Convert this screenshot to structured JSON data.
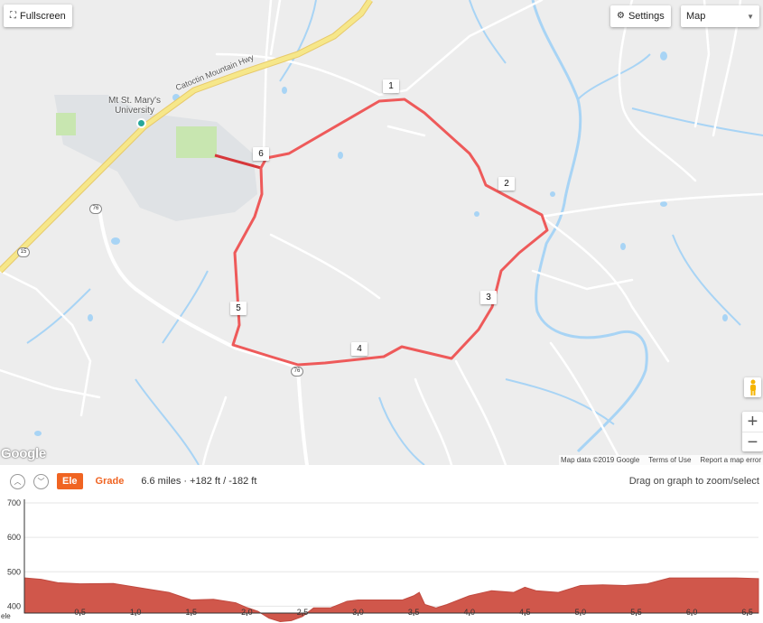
{
  "map": {
    "fullscreen_label": "Fullscreen",
    "settings_label": "Settings",
    "map_type": "Map",
    "place_label": "Mt St. Mary's\nUniversity",
    "highway_label": "Catoctin Mountain Hwy",
    "shields": [
      "76",
      "15",
      "76"
    ],
    "mile_markers": [
      "1",
      "2",
      "3",
      "4",
      "5",
      "6"
    ],
    "google_logo": "Google",
    "attribution": [
      "Map data ©2019 Google",
      "Terms of Use",
      "Report a map error"
    ],
    "zoom_in": "+",
    "zoom_out": "−",
    "colors": {
      "route": "#ee5a5a",
      "water": "#a8d4f5",
      "land": "#ededed",
      "road": "#ffffff",
      "highway": "#f6e78a"
    }
  },
  "elevation": {
    "ele_tab": "Ele",
    "grade_tab": "Grade",
    "stats": "6.6 miles · +182 ft / -182 ft",
    "drag_hint": "Drag on graph to zoom/select",
    "up_icon": "chevron-up-icon",
    "down_icon": "chevron-down-icon"
  },
  "chart_data": {
    "type": "area",
    "title": "",
    "xlabel": "",
    "ylabel": "ele",
    "xlim": [
      0,
      6.6
    ],
    "ylim": [
      380,
      700
    ],
    "y_ticks": [
      "700",
      "600",
      "500",
      "400"
    ],
    "x_ticks": [
      "0.5",
      "1.0",
      "1.5",
      "2.0",
      "2.5",
      "3.0",
      "3.5",
      "4.0",
      "4.5",
      "5.0",
      "5.5",
      "6.0",
      "6.5"
    ],
    "fill_color": "#d0574b",
    "x": [
      0,
      0.15,
      0.3,
      0.5,
      0.8,
      1.1,
      1.3,
      1.5,
      1.7,
      1.9,
      2.0,
      2.1,
      2.2,
      2.3,
      2.4,
      2.5,
      2.6,
      2.75,
      2.9,
      3.0,
      3.2,
      3.4,
      3.5,
      3.55,
      3.6,
      3.7,
      3.8,
      4.0,
      4.2,
      4.4,
      4.5,
      4.6,
      4.8,
      5.0,
      5.2,
      5.4,
      5.6,
      5.8,
      6.0,
      6.2,
      6.4,
      6.6
    ],
    "values": [
      482,
      478,
      468,
      465,
      466,
      450,
      440,
      418,
      420,
      410,
      396,
      385,
      365,
      355,
      358,
      370,
      395,
      395,
      414,
      418,
      418,
      418,
      430,
      440,
      405,
      395,
      405,
      430,
      445,
      440,
      455,
      445,
      440,
      460,
      462,
      460,
      465,
      482,
      482,
      482,
      482,
      480
    ]
  }
}
